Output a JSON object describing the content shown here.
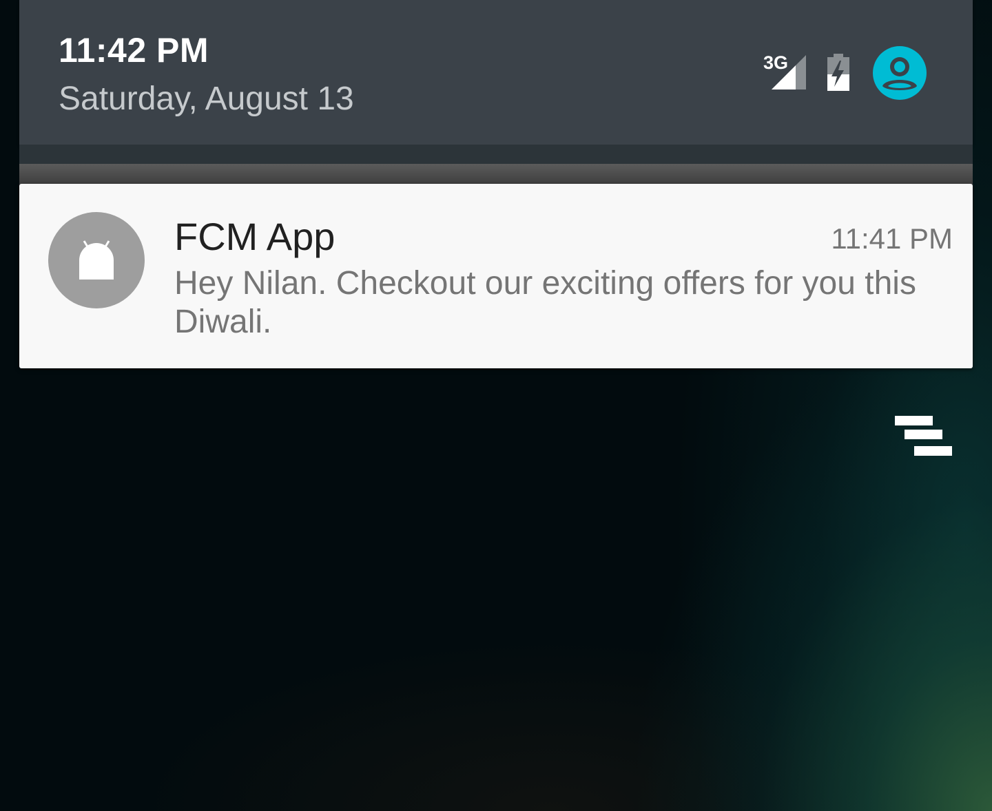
{
  "header": {
    "time": "11:42 PM",
    "date": "Saturday, August 13",
    "network_label": "3G",
    "icons": [
      "signal-icon",
      "battery-charging-icon",
      "user-avatar-icon"
    ],
    "avatar_color": "#00bcd4"
  },
  "notification": {
    "app_name": "FCM App",
    "time": "11:41 PM",
    "message": "Hey Nilan. Checkout our exciting offers for you this Diwali.",
    "icon": "android-icon",
    "icon_bg_color": "#9e9e9e"
  },
  "actions": {
    "clear_all_icon": "clear-all-icon"
  }
}
